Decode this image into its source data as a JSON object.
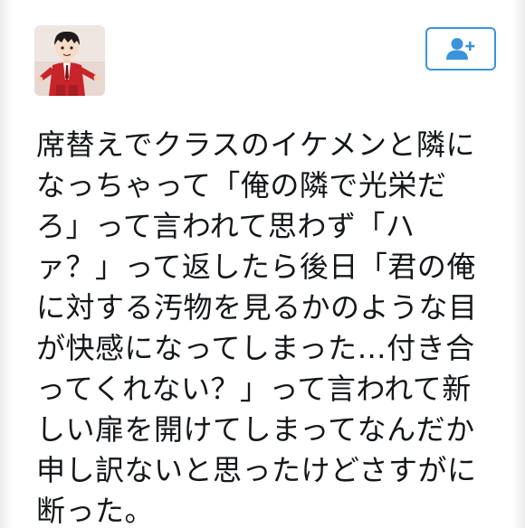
{
  "tweet": {
    "lines": [
      "席替えでクラスのイケメンと隣に",
      "なっちゃって「俺の隣で光栄だ",
      "ろ」って言われて思わず「ハ",
      "ァ？」って返したら後日「君の俺",
      "に対する汚物を見るかのような目",
      "が快感になってしまった…付き合",
      "ってくれない？」って言われて新",
      "しい扉を開けてしまってなんだか",
      "申し訳ないと思ったけどさすがに",
      "断った。"
    ]
  },
  "icons": {
    "avatar": "anime-character-red-suit-avatar",
    "follow": "follow-user-plus-icon"
  },
  "colors": {
    "accent": "#3b94d9",
    "text": "#14171a",
    "background": "#ffffff"
  }
}
